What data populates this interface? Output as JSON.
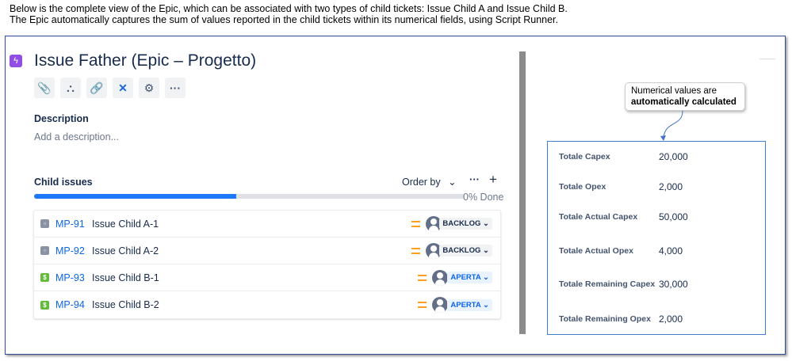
{
  "intro": [
    "Below is the complete view of the Epic, which can be associated with two types of child tickets: Issue Child A and Issue Child B.",
    "The Epic automatically captures the sum of values reported in the child tickets within its numerical fields, using Script Runner."
  ],
  "issue": {
    "title": "Issue Father (Epic – Progetto)",
    "description_label": "Description",
    "description_placeholder": "Add a description..."
  },
  "toolbar": [
    "attachment-icon",
    "hierarchy-icon",
    "link-icon",
    "confluence-icon",
    "apps-icon",
    "more-icon"
  ],
  "child_issues": {
    "label": "Child issues",
    "order_by": "Order by",
    "done_text": "0% Done",
    "progress": 0.47,
    "items": [
      {
        "key": "MP-91",
        "summary": "Issue Child A-1",
        "type": "task",
        "status": "BACKLOG"
      },
      {
        "key": "MP-92",
        "summary": "Issue Child A-2",
        "type": "task",
        "status": "BACKLOG"
      },
      {
        "key": "MP-93",
        "summary": "Issue Child B-1",
        "type": "cost",
        "status": "APERTA"
      },
      {
        "key": "MP-94",
        "summary": "Issue Child B-2",
        "type": "cost",
        "status": "APERTA"
      }
    ]
  },
  "callout": {
    "line1": "Numerical values are",
    "line2": "automatically calculated"
  },
  "fields": [
    {
      "label": "Totale Capex",
      "value": "20,000"
    },
    {
      "label": "Totale Opex",
      "value": "2,000"
    },
    {
      "label": "Totale Actual Capex",
      "value": "50,000"
    },
    {
      "label": "Totale Actual Opex",
      "value": "4,000"
    },
    {
      "label": "Totale Remaining Capex",
      "value": "30,000"
    },
    {
      "label": "Totale Remaining Opex",
      "value": "2,000"
    }
  ]
}
